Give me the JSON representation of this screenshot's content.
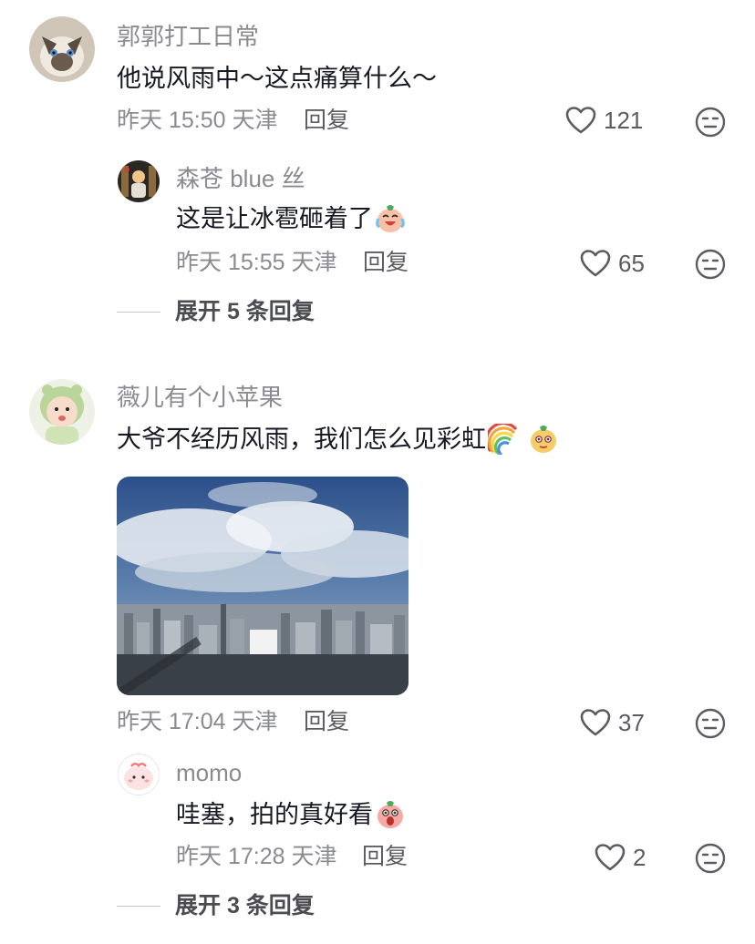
{
  "comments": [
    {
      "username": "郭郭打工日常",
      "text": "他说风雨中～这点痛算什么～",
      "time": "昨天 15:50 天津",
      "reply_label": "回复",
      "likes": "121",
      "replies": [
        {
          "username": "森苍 blue 丝",
          "text": "这是让冰雹砸着了",
          "emoji": "crying-laughing-emoji",
          "time": "昨天 15:55 天津",
          "reply_label": "回复",
          "likes": "65"
        }
      ],
      "expand_label": "展开 5 条回复"
    },
    {
      "username": "薇儿有个小苹果",
      "text": "大爷不经历风雨，我们怎么见彩虹",
      "emoji": [
        "rainbow-emoji",
        "smug-face-emoji"
      ],
      "image": "city-skyline-with-clouds",
      "time": "昨天 17:04 天津",
      "reply_label": "回复",
      "likes": "37",
      "replies": [
        {
          "username": "momo",
          "text": "哇塞，拍的真好看",
          "emoji": "amazed-face-emoji",
          "time": "昨天 17:28 天津",
          "reply_label": "回复",
          "likes": "2"
        }
      ],
      "expand_label": "展开 3 条回复"
    }
  ],
  "colors": {
    "text_primary": "#161823",
    "text_secondary": "#8a8b91",
    "icon": "#5b5c62"
  }
}
